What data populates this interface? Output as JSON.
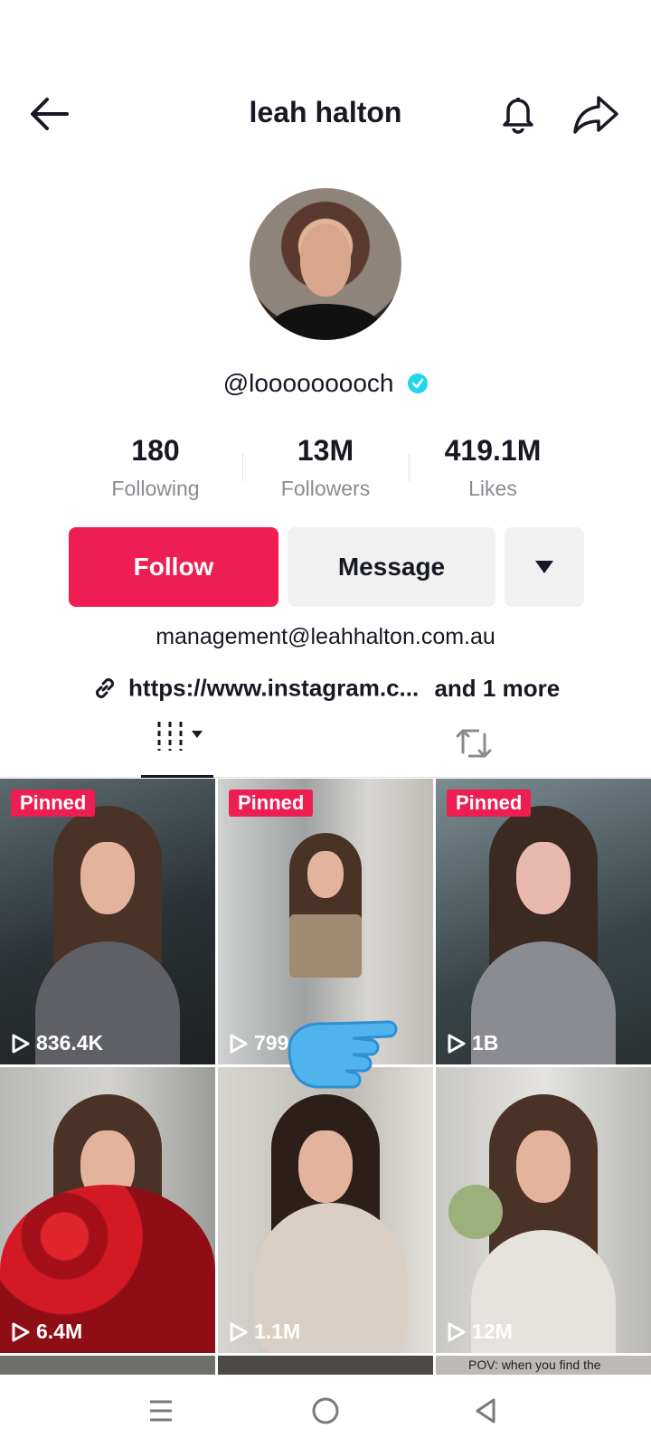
{
  "header": {
    "title": "leah halton",
    "back_icon": "arrow-left-icon",
    "notify_icon": "bell-icon",
    "share_icon": "share-arrow-icon"
  },
  "profile": {
    "username": "@looooooooch",
    "verified": true,
    "stats": [
      {
        "value": "180",
        "label": "Following"
      },
      {
        "value": "13M",
        "label": "Followers"
      },
      {
        "value": "419.1M",
        "label": "Likes"
      }
    ],
    "follow_label": "Follow",
    "message_label": "Message",
    "bio": "management@leahhalton.com.au",
    "link_text": "https://www.instagram.c...",
    "link_more": "and 1 more"
  },
  "tabs": {
    "videos_icon": "grid-icon",
    "reposts_icon": "repost-icon"
  },
  "videos": [
    {
      "pinned": "Pinned",
      "views": "836.4K"
    },
    {
      "pinned": "Pinned",
      "views": "799"
    },
    {
      "pinned": "Pinned",
      "views": "1B"
    },
    {
      "views": "6.4M"
    },
    {
      "views": "1.1M"
    },
    {
      "views": "12M"
    }
  ],
  "partial_caption": "POV: when you find the",
  "colors": {
    "accent": "#ee1d52",
    "verified": "#20d5ec",
    "button_gray": "#f1f1f2"
  },
  "nav": [
    "menu-icon",
    "home-circle-icon",
    "back-triangle-icon"
  ]
}
